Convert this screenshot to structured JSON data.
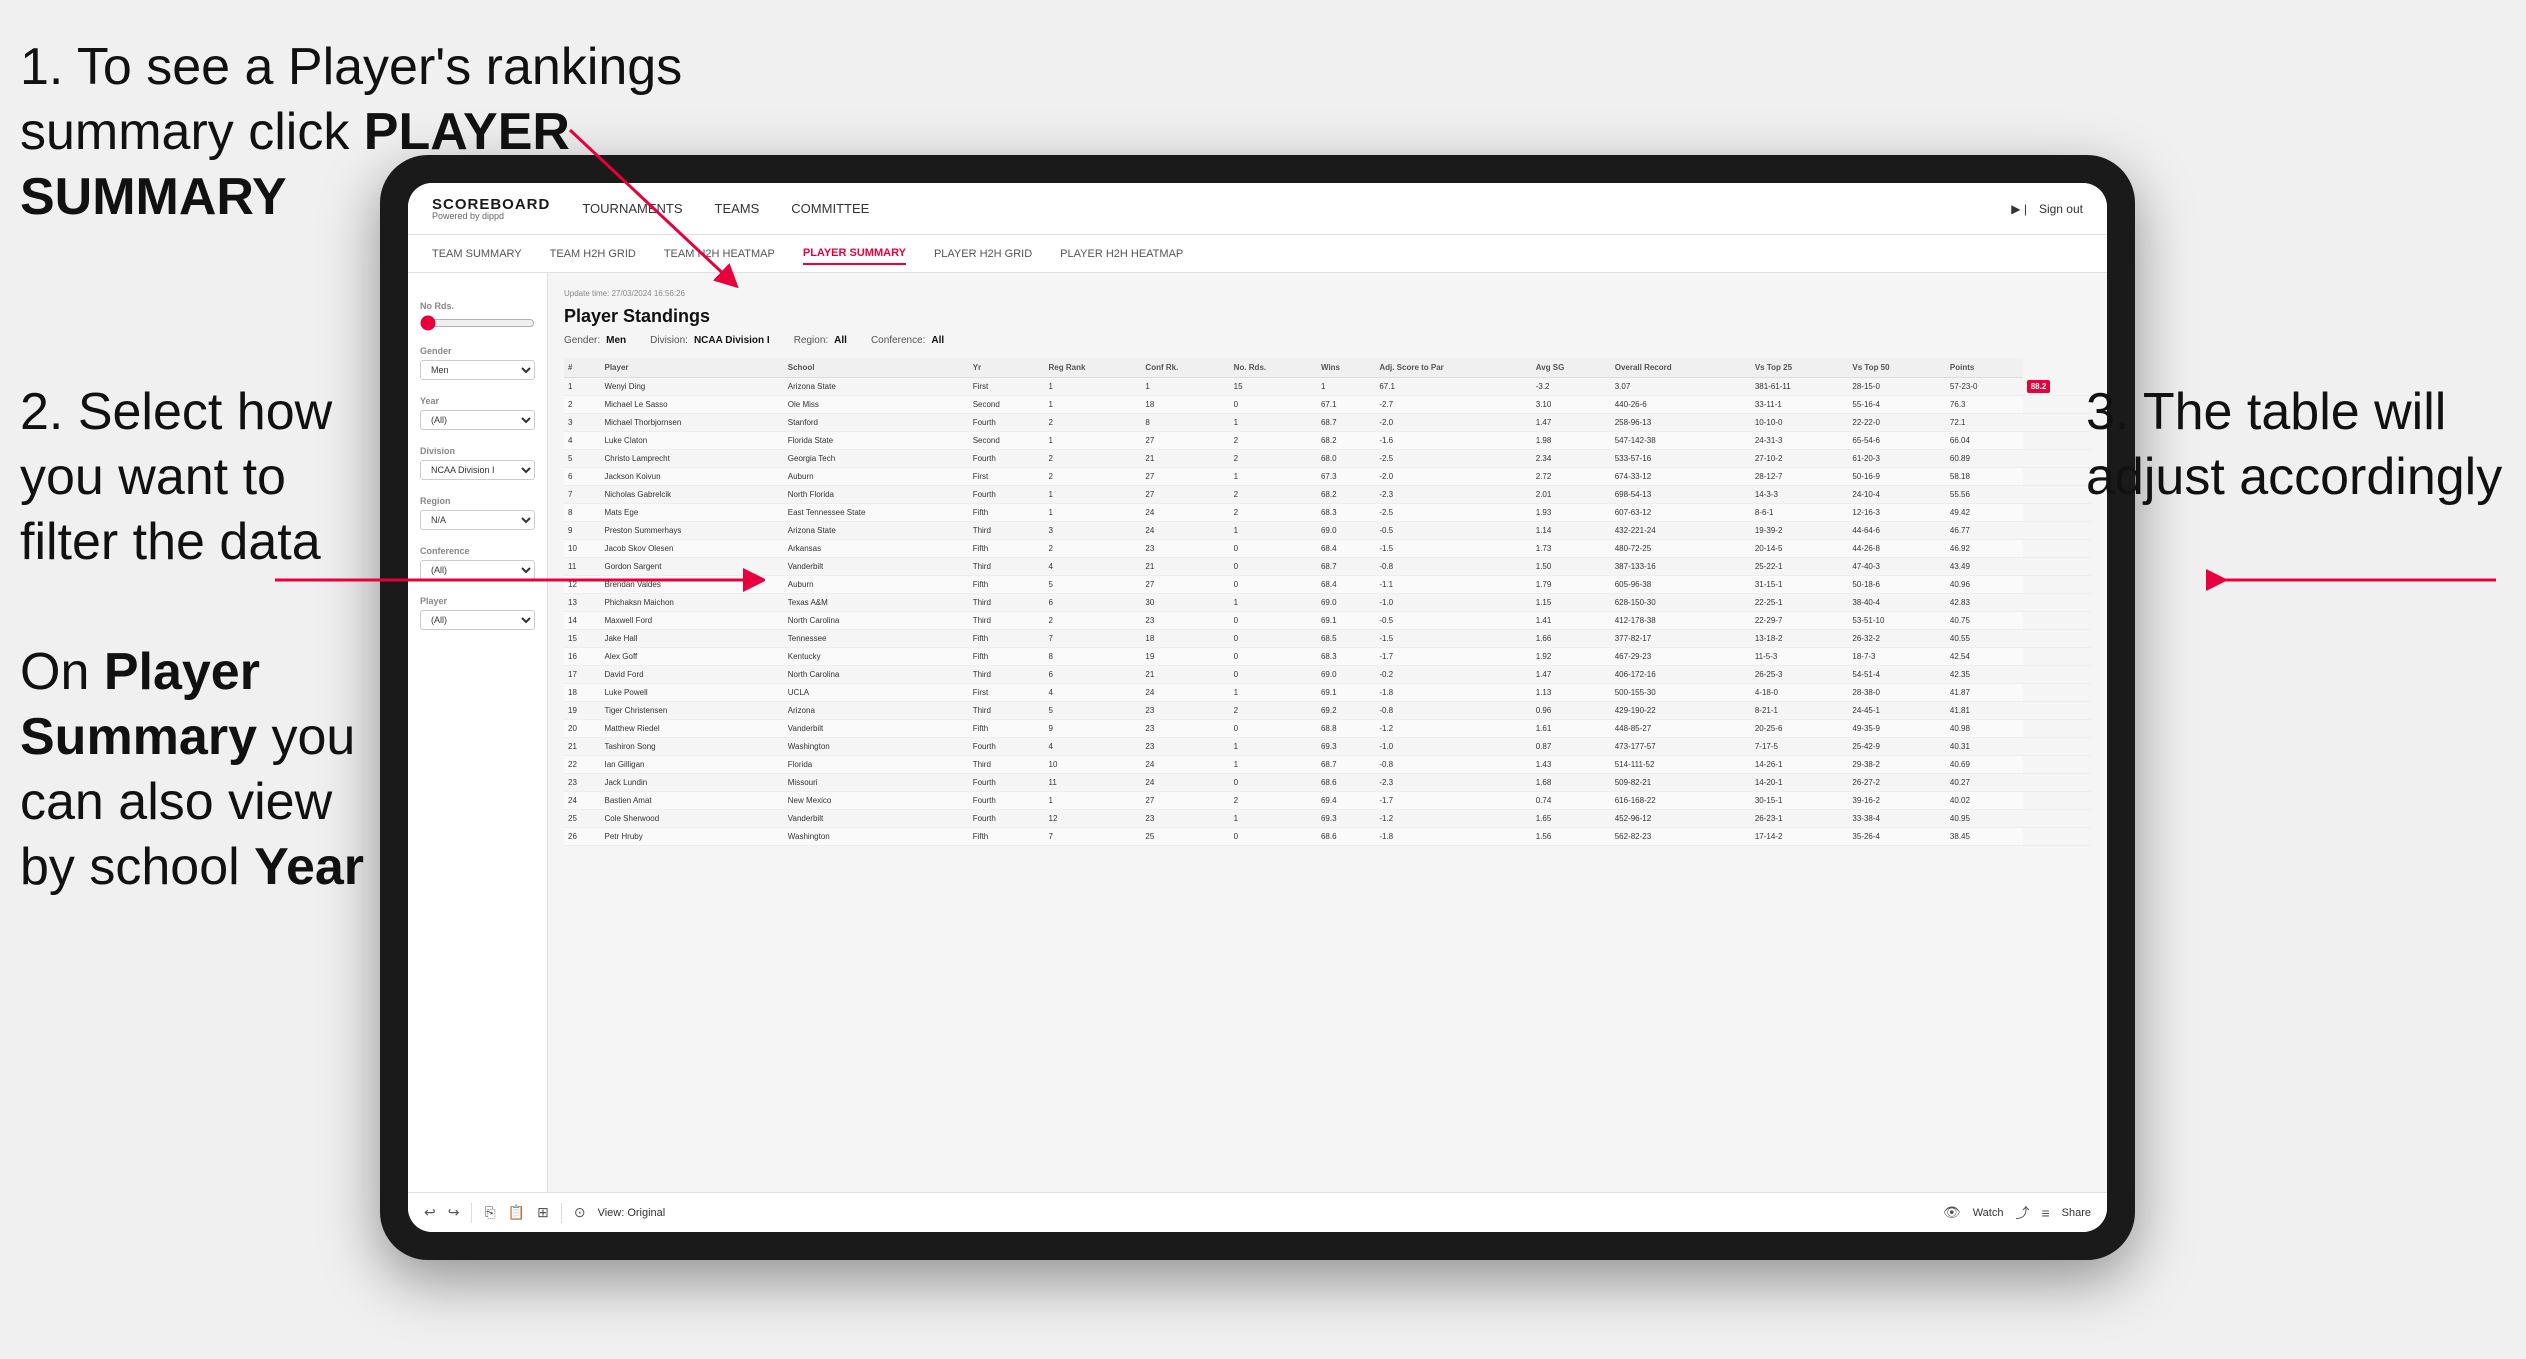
{
  "annotations": {
    "step1": "1. To see a Player's rankings summary click ",
    "step1_bold": "PLAYER SUMMARY",
    "step2_title": "2. Select how you want to filter the data",
    "step3_title": "3. The table will adjust accordingly",
    "bottom_title": "On ",
    "bottom_bold1": "Player Summary",
    "bottom_mid": " you can also view by school ",
    "bottom_bold2": "Year"
  },
  "navbar": {
    "logo": "SCOREBOARD",
    "logo_sub": "Powered by dippd",
    "nav_items": [
      "TOURNAMENTS",
      "TEAMS",
      "COMMITTEE"
    ],
    "nav_right_icon": "▶ |",
    "sign_out": "Sign out"
  },
  "subnav": {
    "items": [
      "TEAM SUMMARY",
      "TEAM H2H GRID",
      "TEAM H2H HEATMAP",
      "PLAYER SUMMARY",
      "PLAYER H2H GRID",
      "PLAYER H2H HEATMAP"
    ],
    "active": "PLAYER SUMMARY"
  },
  "sidebar": {
    "no_rds_label": "No Rds.",
    "gender_label": "Gender",
    "gender_value": "Men",
    "year_label": "Year",
    "year_value": "(All)",
    "division_label": "Division",
    "division_value": "NCAA Division I",
    "region_label": "Region",
    "region_value": "N/A",
    "conference_label": "Conference",
    "conference_value": "(All)",
    "player_label": "Player",
    "player_value": "(All)"
  },
  "table": {
    "title": "Player Standings",
    "update_time": "Update time: 27/03/2024 16:56:26",
    "gender": "Men",
    "division": "NCAA Division I",
    "region": "All",
    "conference": "All",
    "columns": [
      "#",
      "Player",
      "School",
      "Yr",
      "Reg Rank",
      "Conf Rk.",
      "No. Rds.",
      "Wins",
      "Adj. Score to Par",
      "Avg SG",
      "Overall Record",
      "Vs Top 25",
      "Vs Top 50",
      "Points"
    ],
    "rows": [
      [
        "1",
        "Wenyi Ding",
        "Arizona State",
        "First",
        "1",
        "1",
        "15",
        "1",
        "67.1",
        "-3.2",
        "3.07",
        "381-61-11",
        "28-15-0",
        "57-23-0",
        "88.2"
      ],
      [
        "2",
        "Michael Le Sasso",
        "Ole Miss",
        "Second",
        "1",
        "18",
        "0",
        "67.1",
        "-2.7",
        "3.10",
        "440-26-6",
        "33-11-1",
        "55-16-4",
        "76.3"
      ],
      [
        "3",
        "Michael Thorbjornsen",
        "Stanford",
        "Fourth",
        "2",
        "8",
        "1",
        "68.7",
        "-2.0",
        "1.47",
        "258-96-13",
        "10-10-0",
        "22-22-0",
        "72.1"
      ],
      [
        "4",
        "Luke Claton",
        "Florida State",
        "Second",
        "1",
        "27",
        "2",
        "68.2",
        "-1.6",
        "1.98",
        "547-142-38",
        "24-31-3",
        "65-54-6",
        "66.04"
      ],
      [
        "5",
        "Christo Lamprecht",
        "Georgia Tech",
        "Fourth",
        "2",
        "21",
        "2",
        "68.0",
        "-2.5",
        "2.34",
        "533-57-16",
        "27-10-2",
        "61-20-3",
        "60.89"
      ],
      [
        "6",
        "Jackson Koivun",
        "Auburn",
        "First",
        "2",
        "27",
        "1",
        "67.3",
        "-2.0",
        "2.72",
        "674-33-12",
        "28-12-7",
        "50-16-9",
        "58.18"
      ],
      [
        "7",
        "Nicholas Gabrelcik",
        "North Florida",
        "Fourth",
        "1",
        "27",
        "2",
        "68.2",
        "-2.3",
        "2.01",
        "698-54-13",
        "14-3-3",
        "24-10-4",
        "55.56"
      ],
      [
        "8",
        "Mats Ege",
        "East Tennessee State",
        "Fifth",
        "1",
        "24",
        "2",
        "68.3",
        "-2.5",
        "1.93",
        "607-63-12",
        "8-6-1",
        "12-16-3",
        "49.42"
      ],
      [
        "9",
        "Preston Summerhays",
        "Arizona State",
        "Third",
        "3",
        "24",
        "1",
        "69.0",
        "-0.5",
        "1.14",
        "432-221-24",
        "19-39-2",
        "44-64-6",
        "46.77"
      ],
      [
        "10",
        "Jacob Skov Olesen",
        "Arkansas",
        "Fifth",
        "2",
        "23",
        "0",
        "68.4",
        "-1.5",
        "1.73",
        "480-72-25",
        "20-14-5",
        "44-26-8",
        "46.92"
      ],
      [
        "11",
        "Gordon Sargent",
        "Vanderbilt",
        "Third",
        "4",
        "21",
        "0",
        "68.7",
        "-0.8",
        "1.50",
        "387-133-16",
        "25-22-1",
        "47-40-3",
        "43.49"
      ],
      [
        "12",
        "Brendan Valdes",
        "Auburn",
        "Fifth",
        "5",
        "27",
        "0",
        "68.4",
        "-1.1",
        "1.79",
        "605-96-38",
        "31-15-1",
        "50-18-6",
        "40.96"
      ],
      [
        "13",
        "Phichaksn Maichon",
        "Texas A&M",
        "Third",
        "6",
        "30",
        "1",
        "69.0",
        "-1.0",
        "1.15",
        "628-150-30",
        "22-25-1",
        "38-40-4",
        "42.83"
      ],
      [
        "14",
        "Maxwell Ford",
        "North Carolina",
        "Third",
        "2",
        "23",
        "0",
        "69.1",
        "-0.5",
        "1.41",
        "412-178-38",
        "22-29-7",
        "53-51-10",
        "40.75"
      ],
      [
        "15",
        "Jake Hall",
        "Tennessee",
        "Fifth",
        "7",
        "18",
        "0",
        "68.5",
        "-1.5",
        "1.66",
        "377-82-17",
        "13-18-2",
        "26-32-2",
        "40.55"
      ],
      [
        "16",
        "Alex Goff",
        "Kentucky",
        "Fifth",
        "8",
        "19",
        "0",
        "68.3",
        "-1.7",
        "1.92",
        "467-29-23",
        "11-5-3",
        "18-7-3",
        "42.54"
      ],
      [
        "17",
        "David Ford",
        "North Carolina",
        "Third",
        "6",
        "21",
        "0",
        "69.0",
        "-0.2",
        "1.47",
        "406-172-16",
        "26-25-3",
        "54-51-4",
        "42.35"
      ],
      [
        "18",
        "Luke Powell",
        "UCLA",
        "First",
        "4",
        "24",
        "1",
        "69.1",
        "-1.8",
        "1.13",
        "500-155-30",
        "4-18-0",
        "28-38-0",
        "41.87"
      ],
      [
        "19",
        "Tiger Christensen",
        "Arizona",
        "Third",
        "5",
        "23",
        "2",
        "69.2",
        "-0.8",
        "0.96",
        "429-190-22",
        "8-21-1",
        "24-45-1",
        "41.81"
      ],
      [
        "20",
        "Matthew Riedel",
        "Vanderbilt",
        "Fifth",
        "9",
        "23",
        "0",
        "68.8",
        "-1.2",
        "1.61",
        "448-85-27",
        "20-25-6",
        "49-35-9",
        "40.98"
      ],
      [
        "21",
        "Tashiron Song",
        "Washington",
        "Fourth",
        "4",
        "23",
        "1",
        "69.3",
        "-1.0",
        "0.87",
        "473-177-57",
        "7-17-5",
        "25-42-9",
        "40.31"
      ],
      [
        "22",
        "Ian Gilligan",
        "Florida",
        "Third",
        "10",
        "24",
        "1",
        "68.7",
        "-0.8",
        "1.43",
        "514-111-52",
        "14-26-1",
        "29-38-2",
        "40.69"
      ],
      [
        "23",
        "Jack Lundin",
        "Missouri",
        "Fourth",
        "11",
        "24",
        "0",
        "68.6",
        "-2.3",
        "1.68",
        "509-82-21",
        "14-20-1",
        "26-27-2",
        "40.27"
      ],
      [
        "24",
        "Bastien Amat",
        "New Mexico",
        "Fourth",
        "1",
        "27",
        "2",
        "69.4",
        "-1.7",
        "0.74",
        "616-168-22",
        "30-15-1",
        "39-16-2",
        "40.02"
      ],
      [
        "25",
        "Cole Sherwood",
        "Vanderbilt",
        "Fourth",
        "12",
        "23",
        "1",
        "69.3",
        "-1.2",
        "1.65",
        "452-96-12",
        "26-23-1",
        "33-38-4",
        "40.95"
      ],
      [
        "26",
        "Petr Hruby",
        "Washington",
        "Fifth",
        "7",
        "25",
        "0",
        "68.6",
        "-1.8",
        "1.56",
        "562-82-23",
        "17-14-2",
        "35-26-4",
        "38.45"
      ]
    ]
  },
  "toolbar": {
    "view_label": "View: Original",
    "watch_label": "Watch",
    "share_label": "Share"
  }
}
